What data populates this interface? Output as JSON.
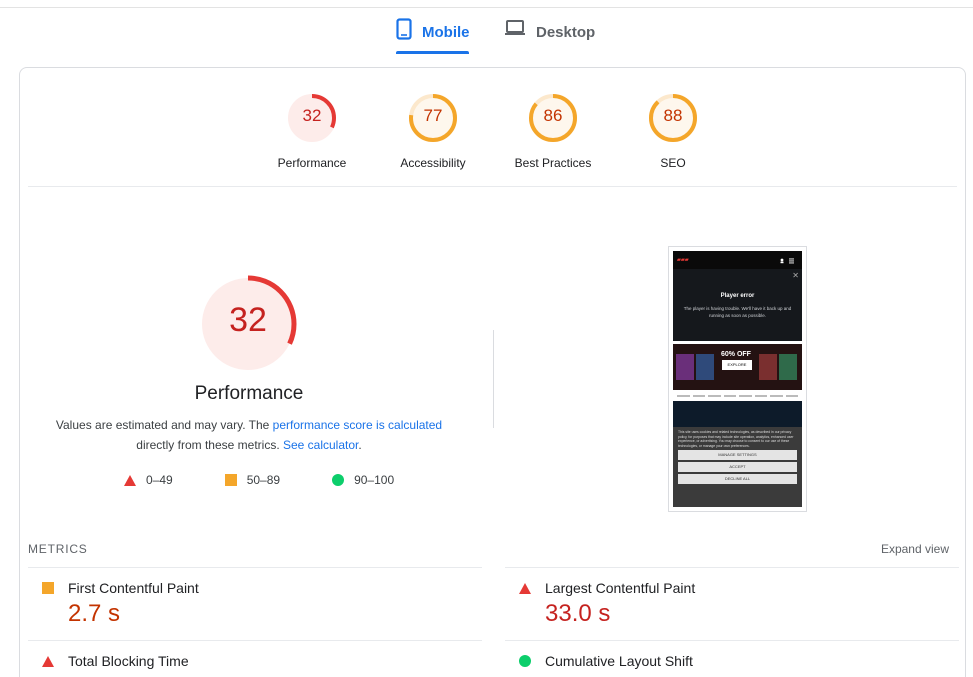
{
  "tabs": {
    "mobile_label": "Mobile",
    "desktop_label": "Desktop",
    "selected": "Mobile"
  },
  "categories": [
    {
      "label": "Performance",
      "score": "32",
      "status": "fail"
    },
    {
      "label": "Accessibility",
      "score": "77",
      "status": "average"
    },
    {
      "label": "Best Practices",
      "score": "86",
      "status": "average"
    },
    {
      "label": "SEO",
      "score": "88",
      "status": "average"
    }
  ],
  "performance": {
    "score": "32",
    "title": "Performance",
    "desc_prefix": "Values are estimated and may vary. The ",
    "desc_link1": "performance score is calculated",
    "desc_middle": " directly from these metrics. ",
    "desc_link2": "See calculator",
    "desc_suffix": "."
  },
  "legend": [
    {
      "range": "0–49",
      "shape": "triangle",
      "color": "#e53935"
    },
    {
      "range": "50–89",
      "shape": "square",
      "color": "#f4a62a"
    },
    {
      "range": "90–100",
      "shape": "circle",
      "color": "#0cce6b"
    }
  ],
  "screenshot": {
    "error_title": "Player error",
    "error_text": "The player is having trouble. We'll have it back up and running as soon as possible.",
    "promo_text": "60% OFF",
    "promo_button": "EXPLORE",
    "cookie_text": "This site uses cookies and related technologies, as described in our privacy policy, for purposes that may include site operation, analytics, enhanced user experience, or advertising. You may choose to consent to our use of these technologies, or manage your own preferences.",
    "cookie_buttons": [
      "MANAGE SETTINGS",
      "ACCEPT",
      "DECLINE ALL"
    ]
  },
  "metrics": {
    "heading": "METRICS",
    "expand_label": "Expand view",
    "items": [
      {
        "label": "First Contentful Paint",
        "value": "2.7 s",
        "status": "average"
      },
      {
        "label": "Largest Contentful Paint",
        "value": "33.0 s",
        "status": "fail"
      },
      {
        "label": "Total Blocking Time",
        "value": "",
        "status": "fail"
      },
      {
        "label": "Cumulative Layout Shift",
        "value": "",
        "status": "pass"
      }
    ]
  },
  "colors": {
    "accent": "#1a73e8",
    "fail": "#e53935",
    "fail_text": "#c5221f",
    "average": "#f4a62a",
    "average_text": "#c33300",
    "pass": "#0cce6b"
  }
}
